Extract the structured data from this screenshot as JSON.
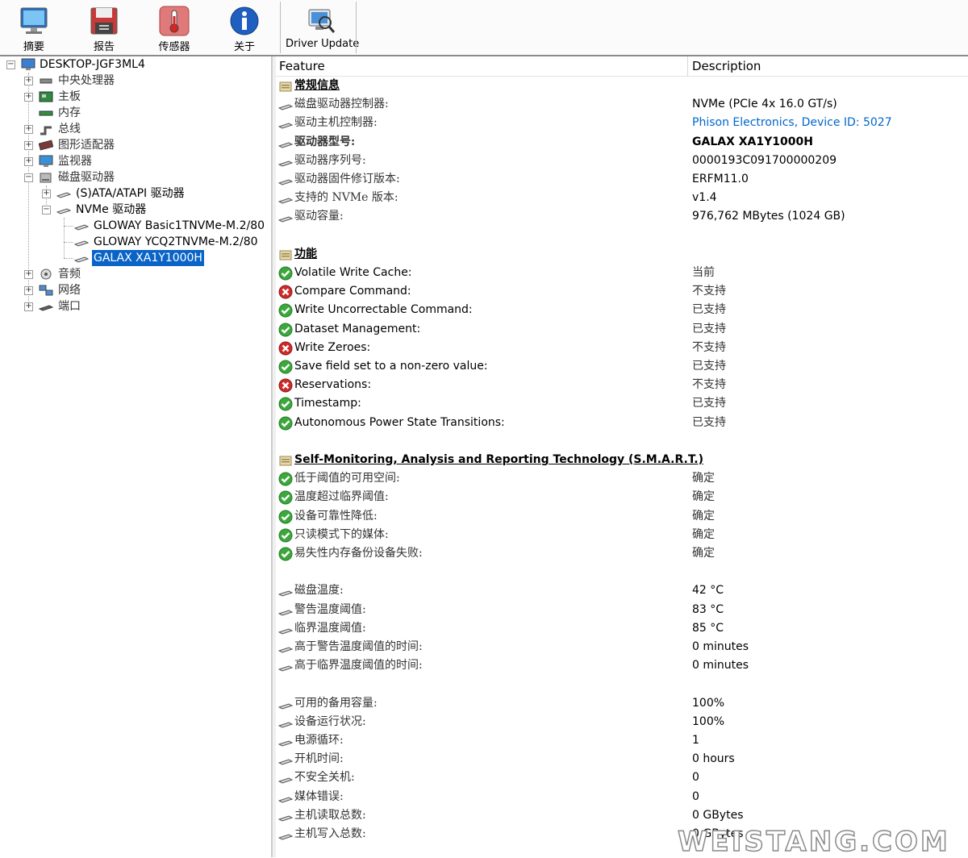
{
  "toolbar": {
    "buttons": [
      {
        "label": "摘要",
        "icon": "monitor-icon"
      },
      {
        "label": "报告",
        "icon": "floppy-disk-icon"
      },
      {
        "label": "传感器",
        "icon": "thermometer-icon"
      },
      {
        "label": "关于",
        "icon": "info-icon"
      },
      {
        "label": "Driver Update",
        "icon": "magnifier-monitor-icon"
      }
    ]
  },
  "tree": {
    "root": "DESKTOP-JGF3ML4",
    "items": [
      {
        "label": "中央处理器",
        "icon": "cpu-icon"
      },
      {
        "label": "主板",
        "icon": "motherboard-icon"
      },
      {
        "label": "内存",
        "icon": "memory-icon"
      },
      {
        "label": "总线",
        "icon": "bus-icon"
      },
      {
        "label": "图形适配器",
        "icon": "graphics-card-icon"
      },
      {
        "label": "监视器",
        "icon": "monitor-icon"
      },
      {
        "label": "磁盘驱动器",
        "icon": "drive-icon"
      },
      {
        "label": "(S)ATA/ATAPI 驱动器",
        "icon": "drive-icon"
      },
      {
        "label": "NVMe 驱动器",
        "icon": "drive-icon"
      },
      {
        "label": "GLOWAY Basic1TNVMe-M.2/80",
        "icon": "drive-icon"
      },
      {
        "label": "GLOWAY YCQ2TNVMe-M.2/80",
        "icon": "drive-icon"
      },
      {
        "label": "GALAX XA1Y1000H",
        "icon": "drive-icon"
      },
      {
        "label": "音频",
        "icon": "speaker-icon"
      },
      {
        "label": "网络",
        "icon": "network-icon"
      },
      {
        "label": "端口",
        "icon": "port-icon"
      }
    ]
  },
  "columns": {
    "feature": "Feature",
    "description": "Description"
  },
  "rows": [
    {
      "type": "section",
      "feature": "常规信息"
    },
    {
      "type": "drive",
      "feature": "磁盘驱动器控制器:",
      "desc": "NVMe (PCIe 4x 16.0 GT/s)"
    },
    {
      "type": "drive",
      "feature": "驱动主机控制器:",
      "desc": "Phison Electronics, Device ID: 5027"
    },
    {
      "type": "drive",
      "feature": "驱动器型号:",
      "desc": "GALAX XA1Y1000H"
    },
    {
      "type": "drive",
      "feature": "驱动器序列号:",
      "desc": "0000193C091700000209"
    },
    {
      "type": "drive",
      "feature": "驱动器固件修订版本:",
      "desc": "ERFM11.0"
    },
    {
      "type": "drive",
      "feature": "支持的 NVMe 版本:",
      "desc": "v1.4"
    },
    {
      "type": "drive",
      "feature": "驱动容量:",
      "desc": "976,762 MBytes (1024 GB)"
    },
    {
      "type": "blank"
    },
    {
      "type": "section",
      "feature": "功能"
    },
    {
      "type": "ok",
      "feature": "Volatile Write Cache:",
      "desc": "当前"
    },
    {
      "type": "err",
      "feature": "Compare Command:",
      "desc": "不支持"
    },
    {
      "type": "ok",
      "feature": "Write Uncorrectable Command:",
      "desc": "已支持"
    },
    {
      "type": "ok",
      "feature": "Dataset Management:",
      "desc": "已支持"
    },
    {
      "type": "err",
      "feature": "Write Zeroes:",
      "desc": "不支持"
    },
    {
      "type": "ok",
      "feature": "Save field set to a non-zero value:",
      "desc": "已支持"
    },
    {
      "type": "err",
      "feature": "Reservations:",
      "desc": "不支持"
    },
    {
      "type": "ok",
      "feature": "Timestamp:",
      "desc": "已支持"
    },
    {
      "type": "ok",
      "feature": "Autonomous Power State Transitions:",
      "desc": "已支持"
    },
    {
      "type": "blank"
    },
    {
      "type": "section",
      "feature": "Self-Monitoring, Analysis and Reporting Technology (S.M.A.R.T.)"
    },
    {
      "type": "ok",
      "feature": "低于阈值的可用空间:",
      "desc": "确定"
    },
    {
      "type": "ok",
      "feature": "温度超过临界阈值:",
      "desc": "确定"
    },
    {
      "type": "ok",
      "feature": "设备可靠性降低:",
      "desc": "确定"
    },
    {
      "type": "ok",
      "feature": "只读模式下的媒体:",
      "desc": "确定"
    },
    {
      "type": "ok",
      "feature": "易失性内存备份设备失败:",
      "desc": "确定"
    },
    {
      "type": "blank"
    },
    {
      "type": "drive",
      "feature": "磁盘温度:",
      "desc": "42 °C"
    },
    {
      "type": "drive",
      "feature": "警告温度阈值:",
      "desc": "83 °C"
    },
    {
      "type": "drive",
      "feature": "临界温度阈值:",
      "desc": "85 °C"
    },
    {
      "type": "drive",
      "feature": "高于警告温度阈值的时间:",
      "desc": "0 minutes"
    },
    {
      "type": "drive",
      "feature": "高于临界温度阈值的时间:",
      "desc": "0 minutes"
    },
    {
      "type": "blank"
    },
    {
      "type": "drive",
      "feature": "可用的备用容量:",
      "desc": "100%"
    },
    {
      "type": "drive",
      "feature": "设备运行状况:",
      "desc": "100%"
    },
    {
      "type": "drive",
      "feature": "电源循环:",
      "desc": "1"
    },
    {
      "type": "drive",
      "feature": "开机时间:",
      "desc": "0 hours"
    },
    {
      "type": "drive",
      "feature": "不安全关机:",
      "desc": "0"
    },
    {
      "type": "drive",
      "feature": "媒体错误:",
      "desc": "0"
    },
    {
      "type": "drive",
      "feature": "主机读取总数:",
      "desc": "0 GBytes"
    },
    {
      "type": "drive",
      "feature": "主机写入总数:",
      "desc": "0 GBytes"
    }
  ],
  "watermark": "WEISTANG.COM",
  "colors": {
    "selection": "#0a64c8",
    "link": "#0066cc",
    "ok": "#3aa83a",
    "error": "#d02a2a"
  }
}
